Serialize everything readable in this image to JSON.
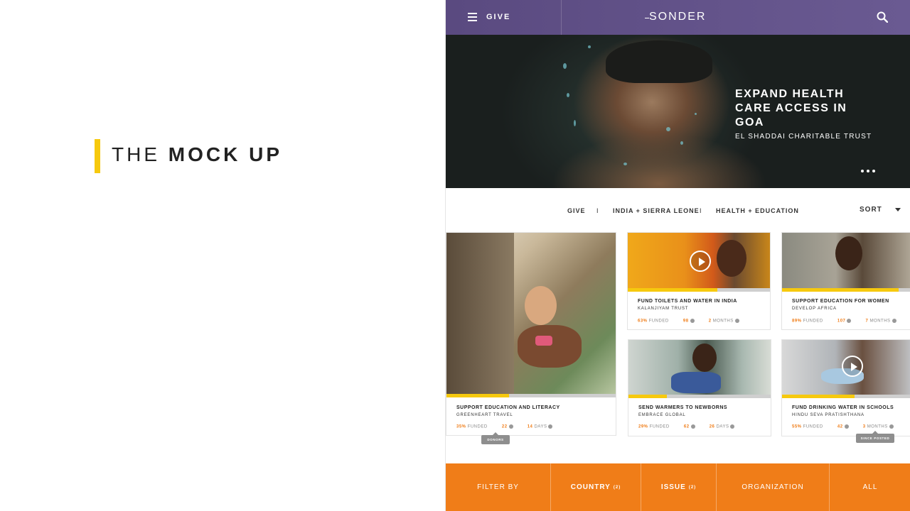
{
  "slide": {
    "title_light": "THE",
    "title_bold": "MOCK UP",
    "accent_color": "#f6c90e"
  },
  "app": {
    "nav_label": "GIVE",
    "brand": "SONDER",
    "header_color": "#5a4a80",
    "icons": [
      "hamburger-icon",
      "search-icon"
    ]
  },
  "hero": {
    "title": "EXPAND HEALTH CARE ACCESS IN GOA",
    "org": "EL SHADDAI CHARITABLE TRUST"
  },
  "filters": {
    "items": [
      "GIVE",
      "INDIA + SIERRA LEONE",
      "HEALTH + EDUCATION"
    ],
    "separator": "I",
    "sort_label": "SORT"
  },
  "cards": [
    {
      "title": "SUPPORT EDUCATION AND LITERACY",
      "org": "GREENHEART TRAVEL",
      "funded": "35%",
      "funded_label": "FUNDED",
      "donors": "22",
      "time": "14",
      "time_label": "DAYS",
      "progress": 0.37
    },
    {
      "title": "FUND TOILETS AND WATER IN INDIA",
      "org": "KALANJIYAM TRUST",
      "funded": "63%",
      "funded_label": "FUNDED",
      "donors": "98",
      "time": "2",
      "time_label": "MONTHS",
      "progress": 0.63
    },
    {
      "title": "SUPPORT EDUCATION FOR WOMEN",
      "org": "DEVELOP AFRICA",
      "funded": "89%",
      "funded_label": "FUNDED",
      "donors": "107",
      "time": "7",
      "time_label": "MONTHS",
      "progress": 0.87
    },
    {
      "title": "SEND WARMERS TO NEWBORNS",
      "org": "EMBRACE GLOBAL",
      "funded": "29%",
      "funded_label": "FUNDED",
      "donors": "62",
      "time": "26",
      "time_label": "DAYS",
      "progress": 0.27
    },
    {
      "title": "FUND DRINKING WATER IN SCHOOLS",
      "org": "HINDU SEVA PRATISHTHANA",
      "funded": "55%",
      "funded_label": "FUNDED",
      "donors": "42",
      "time": "3",
      "time_label": "MONTHS",
      "progress": 0.54
    }
  ],
  "tooltips": {
    "donors": "DONORS",
    "since_posted": "SINCE POSTED"
  },
  "footer": {
    "filter_by": "FILTER BY",
    "country": "COUNTRY",
    "country_count": "(2)",
    "issue": "ISSUE",
    "issue_count": "(2)",
    "organization": "ORGANIZATION",
    "all": "ALL",
    "bar_color": "#f07d18"
  }
}
